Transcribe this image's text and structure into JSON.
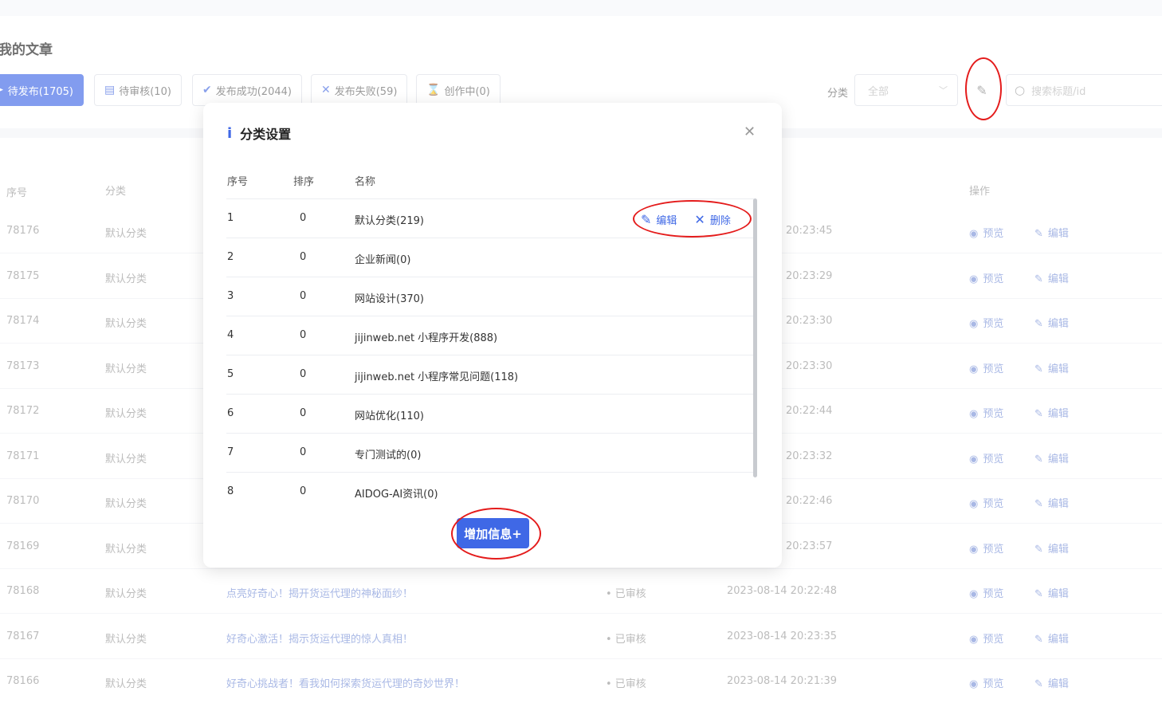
{
  "page": {
    "title": "我的文章"
  },
  "tabs": [
    {
      "label": "待发布(1705)",
      "icon": "send-icon",
      "glyph": "➤"
    },
    {
      "label": "待审核(10)",
      "icon": "document-icon",
      "glyph": "▤"
    },
    {
      "label": "发布成功(2044)",
      "icon": "check-icon",
      "glyph": "✔"
    },
    {
      "label": "发布失败(59)",
      "icon": "close-icon",
      "glyph": "✕"
    },
    {
      "label": "创作中(0)",
      "icon": "hourglass-icon",
      "glyph": "⌛"
    }
  ],
  "filter": {
    "label": "分类",
    "value": "全部"
  },
  "search": {
    "placeholder": "搜索标题/id"
  },
  "table": {
    "headers": {
      "id": "序号",
      "category": "分类",
      "actions": "操作"
    },
    "rows": [
      {
        "id": "78176",
        "category": "默认分类",
        "title": "",
        "status": "",
        "time": "20:23:45"
      },
      {
        "id": "78175",
        "category": "默认分类",
        "title": "",
        "status": "",
        "time": "20:23:29"
      },
      {
        "id": "78174",
        "category": "默认分类",
        "title": "",
        "status": "",
        "time": "20:23:30"
      },
      {
        "id": "78173",
        "category": "默认分类",
        "title": "",
        "status": "",
        "time": "20:23:30"
      },
      {
        "id": "78172",
        "category": "默认分类",
        "title": "",
        "status": "",
        "time": "20:22:44"
      },
      {
        "id": "78171",
        "category": "默认分类",
        "title": "",
        "status": "",
        "time": "20:23:32"
      },
      {
        "id": "78170",
        "category": "默认分类",
        "title": "",
        "status": "",
        "time": "20:22:46"
      },
      {
        "id": "78169",
        "category": "默认分类",
        "title": "",
        "status": "",
        "time": "20:23:57"
      },
      {
        "id": "78168",
        "category": "默认分类",
        "title": "点亮好奇心！揭开货运代理的神秘面纱！",
        "status": "• 已审核",
        "time": "2023-08-14 20:22:48"
      },
      {
        "id": "78167",
        "category": "默认分类",
        "title": "好奇心激活！揭示货运代理的惊人真相！",
        "status": "• 已审核",
        "time": "2023-08-14 20:23:35"
      },
      {
        "id": "78166",
        "category": "默认分类",
        "title": "好奇心挑战者！看我如何探索货运代理的奇妙世界！",
        "status": "• 已审核",
        "time": "2023-08-14 20:21:39"
      }
    ],
    "row_actions": {
      "preview": "预览",
      "edit": "编辑"
    }
  },
  "modal": {
    "title": "分类设置",
    "headers": {
      "no": "序号",
      "sort": "排序",
      "name": "名称"
    },
    "rows": [
      {
        "no": "1",
        "sort": "0",
        "name": "默认分类(219)"
      },
      {
        "no": "2",
        "sort": "0",
        "name": "企业新闻(0)"
      },
      {
        "no": "3",
        "sort": "0",
        "name": "网站设计(370)"
      },
      {
        "no": "4",
        "sort": "0",
        "name": "jijinweb.net 小程序开发(888)"
      },
      {
        "no": "5",
        "sort": "0",
        "name": "jijinweb.net 小程序常见问题(118)"
      },
      {
        "no": "6",
        "sort": "0",
        "name": "网站优化(110)"
      },
      {
        "no": "7",
        "sort": "0",
        "name": "专门测试的(0)"
      },
      {
        "no": "8",
        "sort": "0",
        "name": "AIDOG-AI资讯(0)"
      }
    ],
    "row_actions": {
      "edit": "编辑",
      "delete": "删除"
    },
    "add_button": "增加信息+"
  },
  "colors": {
    "accent": "#3f68e6",
    "highlight": "#e41b1b"
  }
}
